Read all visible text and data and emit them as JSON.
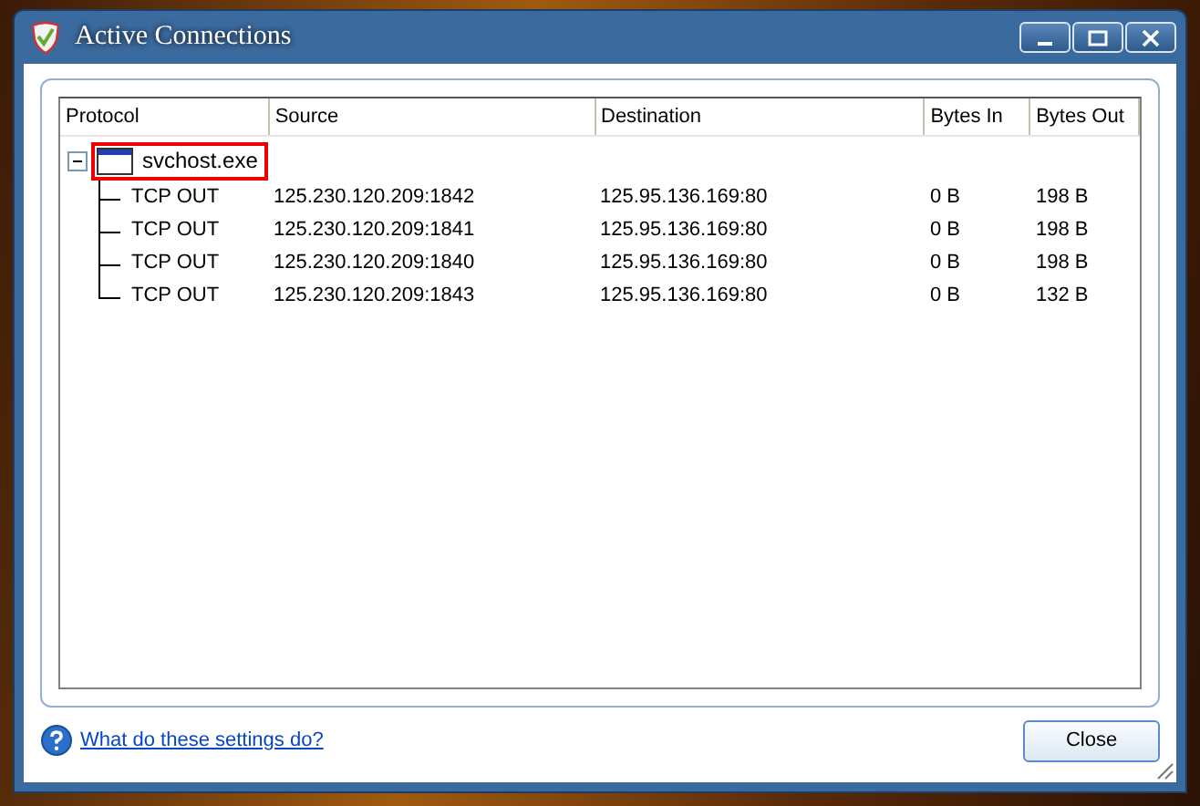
{
  "window": {
    "title": "Active Connections"
  },
  "table": {
    "columns": [
      "Protocol",
      "Source",
      "Destination",
      "Bytes In",
      "Bytes Out"
    ],
    "rows": [
      {
        "name": "svchost.exe",
        "expanded": true,
        "selected": true,
        "children": [
          {
            "protocol": "TCP OUT",
            "source": "125.230.120.209:1842",
            "destination": "125.95.136.169:80",
            "bytes_in": "0 B",
            "bytes_out": "198 B"
          },
          {
            "protocol": "TCP OUT",
            "source": "125.230.120.209:1841",
            "destination": "125.95.136.169:80",
            "bytes_in": "0 B",
            "bytes_out": "198 B"
          },
          {
            "protocol": "TCP OUT",
            "source": "125.230.120.209:1840",
            "destination": "125.95.136.169:80",
            "bytes_in": "0 B",
            "bytes_out": "198 B"
          },
          {
            "protocol": "TCP OUT",
            "source": "125.230.120.209:1843",
            "destination": "125.95.136.169:80",
            "bytes_in": "0 B",
            "bytes_out": "132 B"
          }
        ]
      }
    ]
  },
  "help_link": "What do these settings do?",
  "buttons": [
    "Close"
  ]
}
